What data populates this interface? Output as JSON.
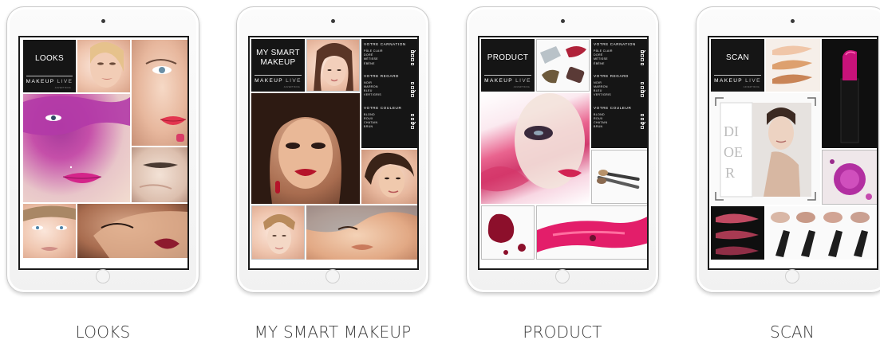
{
  "panels": [
    {
      "mode_label": "LOOKS",
      "caption": "LOOKS"
    },
    {
      "mode_label": "MY SMART MAKEUP",
      "caption": "MY SMART MAKEUP"
    },
    {
      "mode_label": "PRODUCT",
      "caption": "PRODUCT"
    },
    {
      "mode_label": "SCAN",
      "caption": "SCAN"
    }
  ],
  "brand": {
    "name": "MAKEUP",
    "suffix": "LIVE",
    "tagline": "ADVERTISING"
  },
  "questionnaire": {
    "sections": [
      {
        "title": "VOTRE CARNATION",
        "options": [
          {
            "label": "PÂLE CLAIR",
            "checked": true
          },
          {
            "label": "DORÉ",
            "checked": false
          },
          {
            "label": "MÉTISSE",
            "checked": false
          },
          {
            "label": "ÉBÈNE",
            "checked": false
          }
        ]
      },
      {
        "title": "VOTRE REGARD",
        "options": [
          {
            "label": "NOIR",
            "checked": false
          },
          {
            "label": "MARRON",
            "checked": false
          },
          {
            "label": "BLEU",
            "checked": true
          },
          {
            "label": "VERT/GRIS",
            "checked": false
          }
        ]
      },
      {
        "title": "VOTRE COULEUR",
        "options": [
          {
            "label": "BLOND",
            "checked": false
          },
          {
            "label": "ROUX",
            "checked": false
          },
          {
            "label": "CHATAIN",
            "checked": true
          },
          {
            "label": "BRUN",
            "checked": false
          }
        ]
      }
    ]
  },
  "colors": {
    "accent_pink": "#d81b7a",
    "logo_bg": "#151515",
    "caption_text": "#3c3c3c"
  },
  "icons": [
    "camera-icon",
    "home-button-icon",
    "checkbox-checked-icon",
    "checkbox-empty-icon"
  ]
}
